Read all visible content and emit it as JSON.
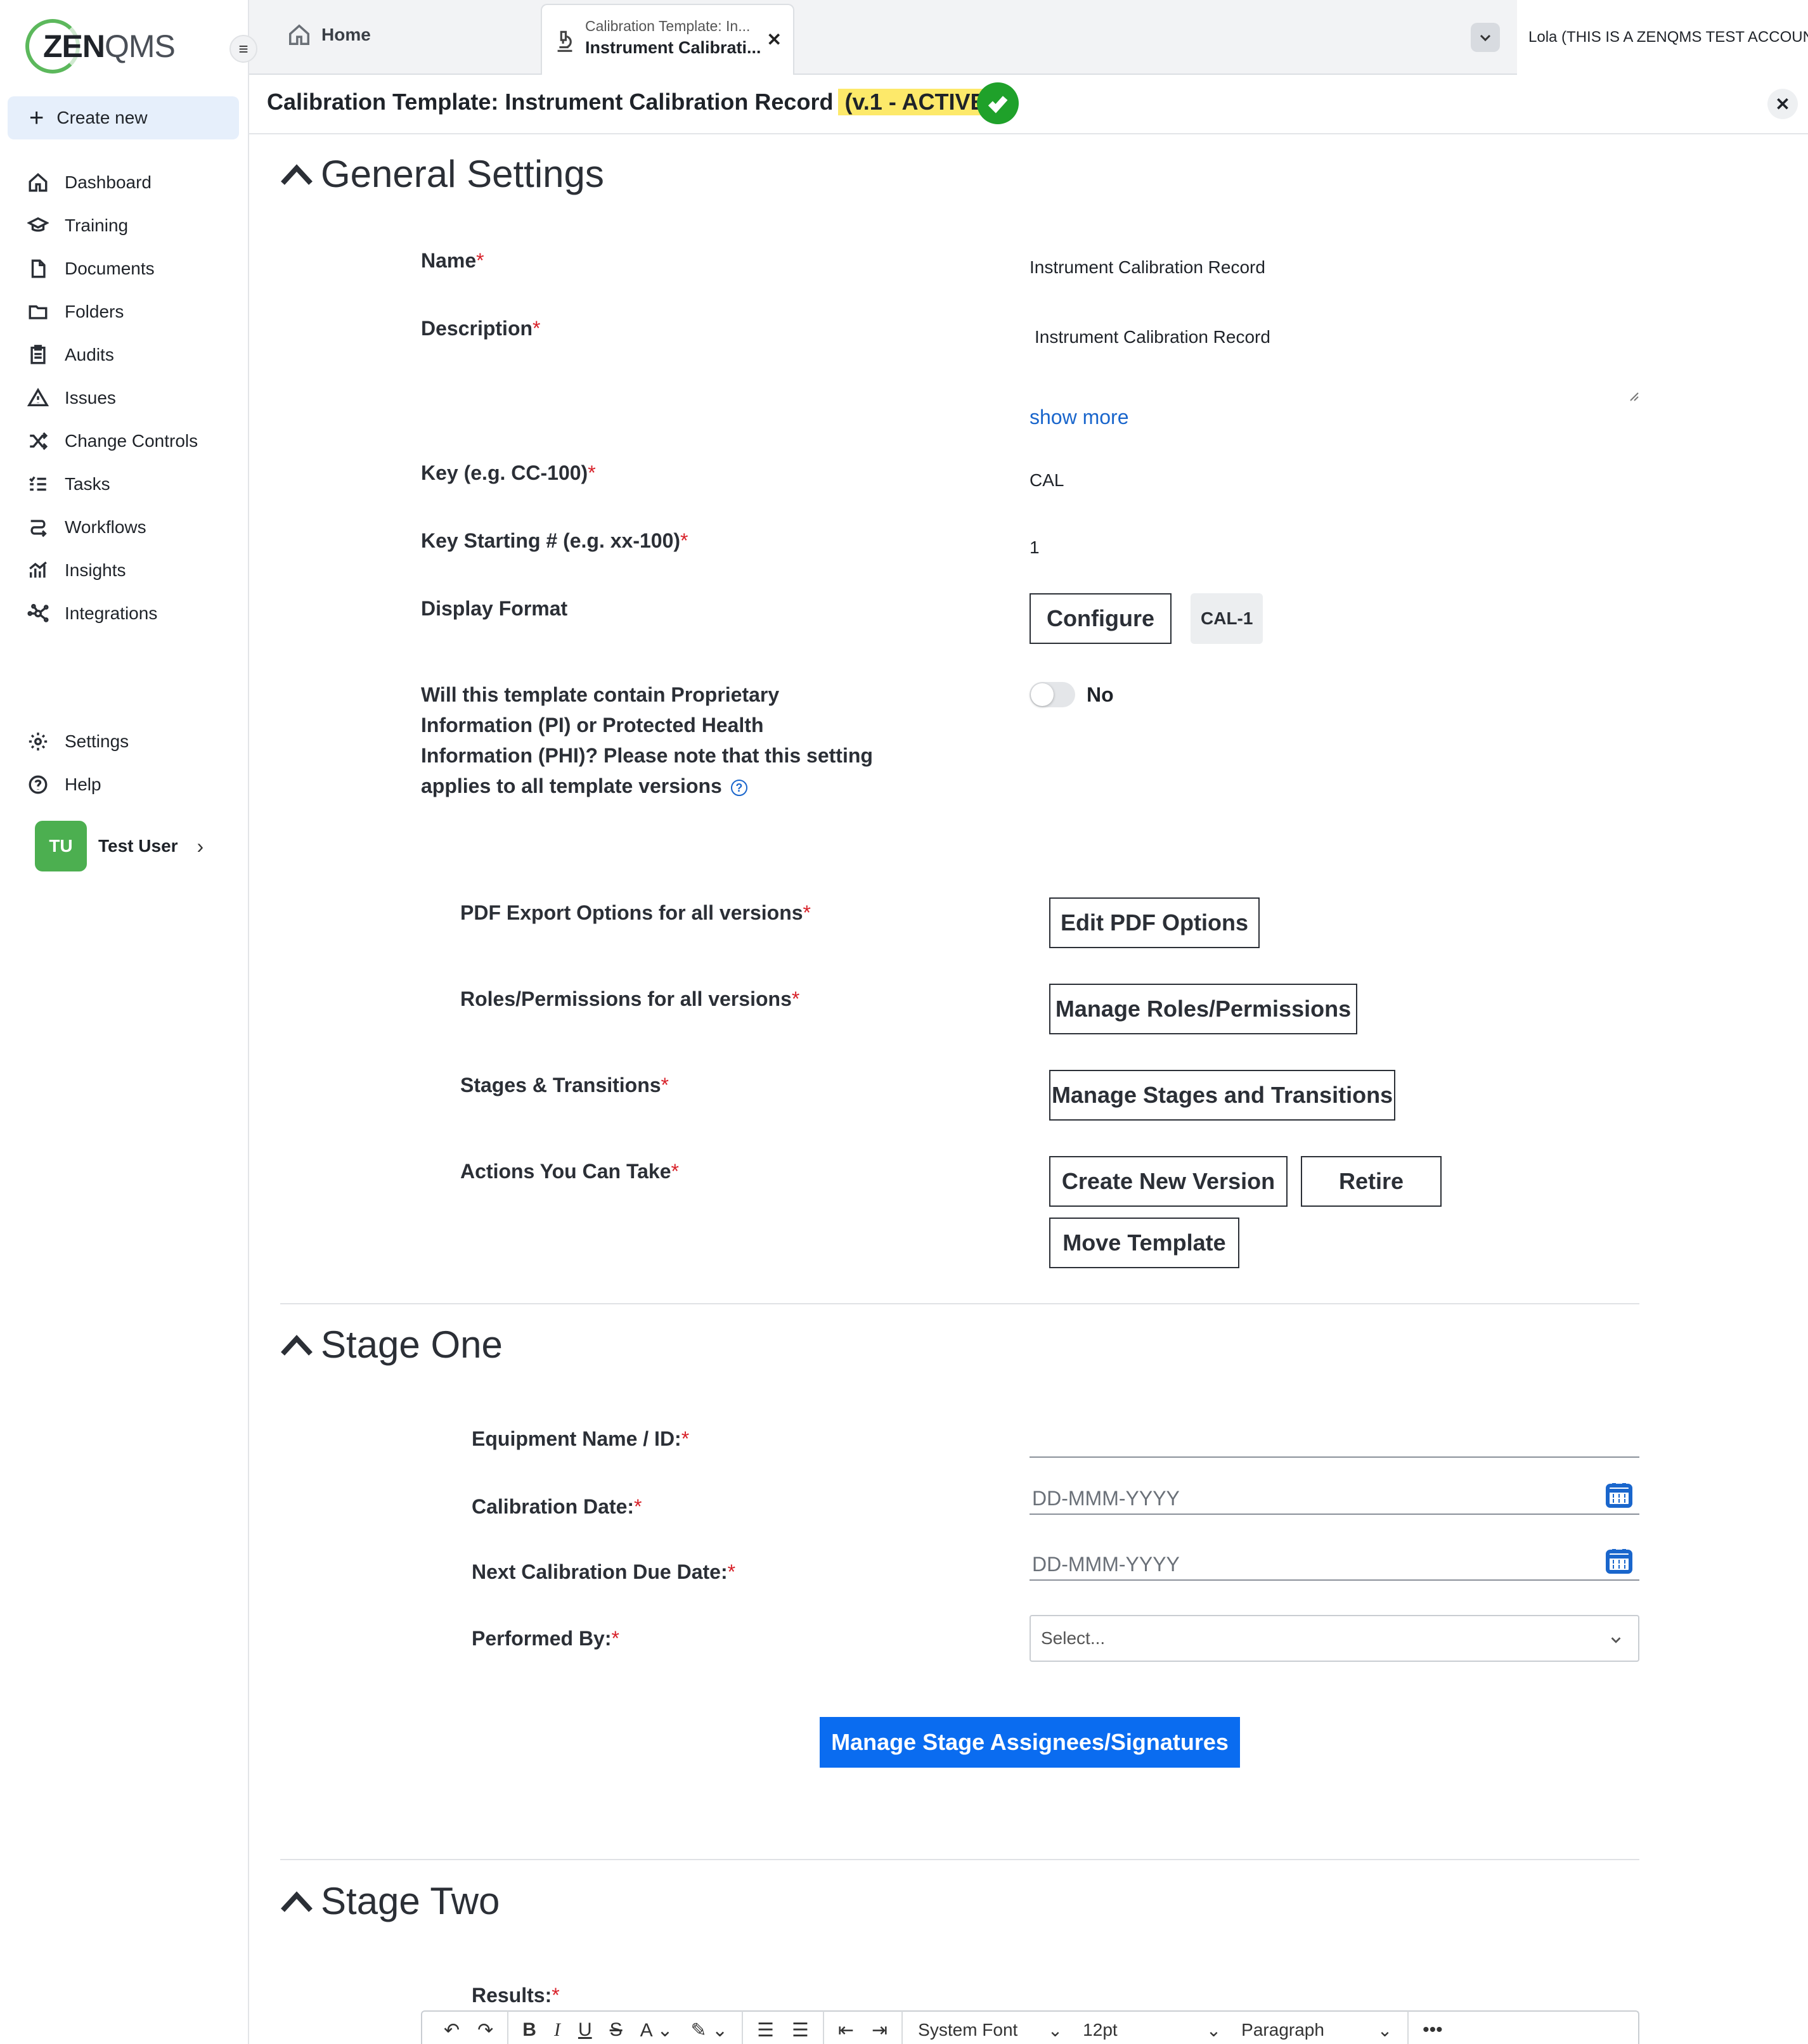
{
  "sidebar": {
    "logo": {
      "zen": "ZEN",
      "qms": "QMS"
    },
    "create_new": "Create new",
    "items": [
      {
        "label": "Dashboard",
        "icon": "home-icon"
      },
      {
        "label": "Training",
        "icon": "graduation-cap-icon"
      },
      {
        "label": "Documents",
        "icon": "document-icon"
      },
      {
        "label": "Folders",
        "icon": "folder-icon"
      },
      {
        "label": "Audits",
        "icon": "clipboard-icon"
      },
      {
        "label": "Issues",
        "icon": "warning-icon"
      },
      {
        "label": "Change Controls",
        "icon": "shuffle-icon"
      },
      {
        "label": "Tasks",
        "icon": "checklist-icon"
      },
      {
        "label": "Workflows",
        "icon": "workflow-icon"
      },
      {
        "label": "Insights",
        "icon": "chart-icon"
      },
      {
        "label": "Integrations",
        "icon": "integrations-icon"
      }
    ],
    "settings": "Settings",
    "help": "Help",
    "user": {
      "initials": "TU",
      "name": "Test User"
    }
  },
  "topbar": {
    "home_tab": "Home",
    "active_tab": {
      "subtitle": "Calibration Template: In...",
      "title": "Instrument Calibrati..."
    },
    "account": "Lola (THIS IS A ZENQMS TEST ACCOUNT"
  },
  "titlebar": {
    "title": "Calibration Template: Instrument Calibration Record",
    "version": "(v.1 - ACTIVE)"
  },
  "general": {
    "heading": "General Settings",
    "name_label": "Name",
    "name_value": "Instrument Calibration Record",
    "description_label": "Description",
    "description_value": "Instrument Calibration Record",
    "show_more": "show more",
    "key_label": "Key (e.g. CC-100)",
    "key_value": "CAL",
    "key_start_label": "Key Starting # (e.g. xx-100)",
    "key_start_value": "1",
    "display_format_label": "Display Format",
    "configure_btn": "Configure",
    "format_preview": "CAL-1",
    "pi_label_lines": [
      "Will this template contain Proprietary",
      "Information (PI) or Protected Health",
      "Information (PHI)? Please note that this setting",
      "applies to all template versions"
    ],
    "pi_value": "No",
    "pdf_label": "PDF Export Options for all versions",
    "pdf_btn": "Edit PDF Options",
    "roles_label": "Roles/Permissions for all versions",
    "roles_btn": "Manage Roles/Permissions",
    "stages_label": "Stages & Transitions",
    "stages_btn": "Manage Stages and Transitions",
    "actions_label": "Actions You Can Take",
    "create_version_btn": "Create New Version",
    "retire_btn": "Retire",
    "move_btn": "Move Template",
    "required_mark": "*"
  },
  "stage_one": {
    "heading": "Stage One",
    "equipment_label": "Equipment Name / ID:",
    "cal_date_label": "Calibration Date:",
    "cal_date_placeholder": "DD-MMM-YYYY",
    "next_date_label": "Next Calibration Due Date:",
    "next_date_placeholder": "DD-MMM-YYYY",
    "performed_label": "Performed By:",
    "performed_placeholder": "Select...",
    "assignees_btn": "Manage Stage Assignees/Signatures"
  },
  "stage_two": {
    "heading": "Stage Two",
    "results_label": "Results:",
    "toolbar": {
      "font": "System Font",
      "size": "12pt",
      "block": "Paragraph",
      "more": "•••"
    }
  },
  "colors": {
    "accent": "#0a6cf0",
    "success": "#1fa12a",
    "highlight": "#fde96a",
    "required": "#d8222a",
    "avatar": "#4caf50"
  }
}
